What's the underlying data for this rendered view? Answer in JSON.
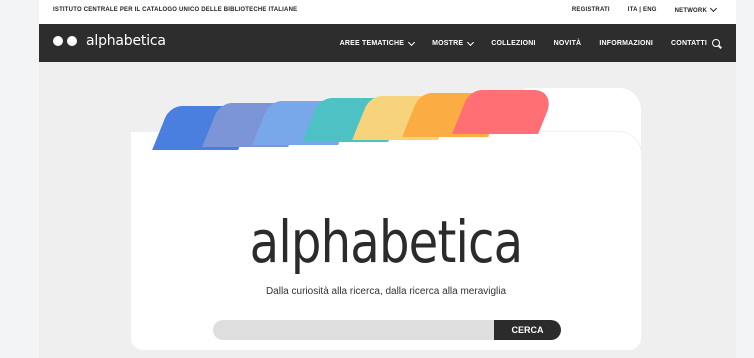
{
  "topbar": {
    "institute": "ISTITUTO CENTRALE PER IL CATALOGO UNICO DELLE BIBLIOTECHE ITALIANE",
    "registrati": "REGISTRATI",
    "language": "ITA | ENG",
    "network": "NETWORK"
  },
  "navbar": {
    "logo_text": "alphabetica",
    "items": [
      "AREE TEMATICHE",
      "MOSTRE",
      "COLLEZIONI",
      "NOVITÀ",
      "INFORMAZIONI",
      "CONTATTI"
    ]
  },
  "hero": {
    "title": "alphabetica",
    "tagline": "Dalla curiosità alla ricerca, dalla ricerca alla meraviglia",
    "search_button": "CERCA",
    "search_placeholder": "",
    "tab_colors": [
      "#4a7fe0",
      "#7b95d6",
      "#78a8ea",
      "#4ec1c5",
      "#f7d47b",
      "#fbac42",
      "#ff6f73"
    ]
  }
}
